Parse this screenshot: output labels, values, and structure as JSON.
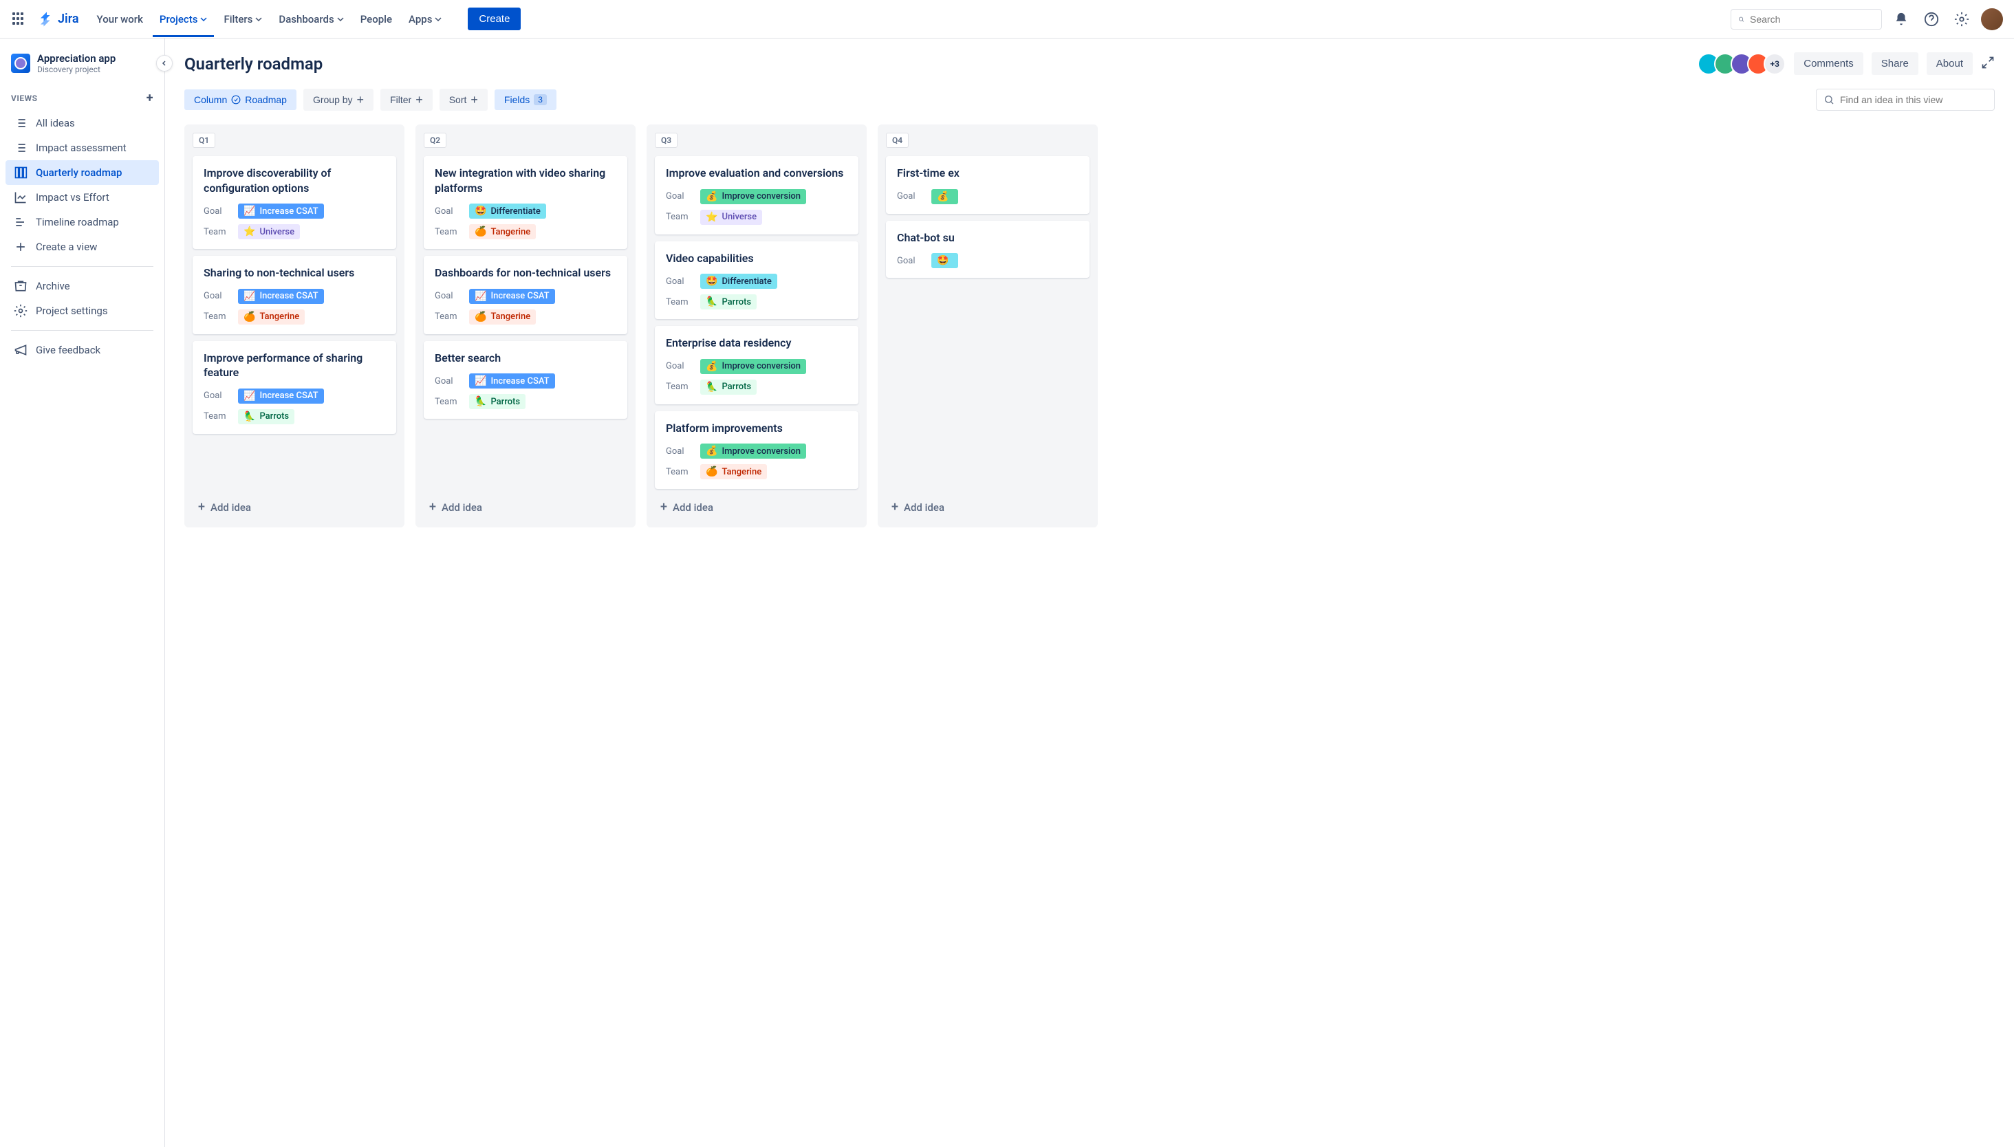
{
  "topbar": {
    "logo": "Jira",
    "nav": [
      "Your work",
      "Projects",
      "Filters",
      "Dashboards",
      "People",
      "Apps"
    ],
    "active_nav": "Projects",
    "create_label": "Create",
    "search_placeholder": "Search"
  },
  "sidebar": {
    "project_name": "Appreciation app",
    "project_type": "Discovery project",
    "views_label": "VIEWS",
    "items": [
      {
        "label": "All ideas",
        "icon": "list"
      },
      {
        "label": "Impact assessment",
        "icon": "list"
      },
      {
        "label": "Quarterly roadmap",
        "icon": "board",
        "active": true
      },
      {
        "label": "Impact vs Effort",
        "icon": "chart"
      },
      {
        "label": "Timeline roadmap",
        "icon": "timeline"
      },
      {
        "label": "Create a view",
        "icon": "plus"
      }
    ],
    "archive_label": "Archive",
    "settings_label": "Project settings",
    "feedback_label": "Give feedback"
  },
  "main": {
    "title": "Quarterly roadmap",
    "avatar_more": "+3",
    "comments_label": "Comments",
    "share_label": "Share",
    "about_label": "About",
    "toolbar": {
      "column_label": "Column",
      "column_value": "Roadmap",
      "groupby_label": "Group by",
      "filter_label": "Filter",
      "sort_label": "Sort",
      "fields_label": "Fields",
      "fields_count": "3",
      "find_placeholder": "Find an idea in this view"
    },
    "field_goal": "Goal",
    "field_team": "Team",
    "add_idea_label": "Add idea",
    "columns": [
      {
        "name": "Q1",
        "cards": [
          {
            "title": "Improve discoverability of configuration options",
            "goal": {
              "text": "Increase CSAT",
              "emoji": "📈",
              "class": "tag-csat"
            },
            "team": {
              "text": "Universe",
              "emoji": "⭐",
              "class": "tag-universe"
            }
          },
          {
            "title": "Sharing to non-technical users",
            "goal": {
              "text": "Increase CSAT",
              "emoji": "📈",
              "class": "tag-csat"
            },
            "team": {
              "text": "Tangerine",
              "emoji": "🍊",
              "class": "tag-tangerine"
            }
          },
          {
            "title": "Improve performance of sharing feature",
            "goal": {
              "text": "Increase CSAT",
              "emoji": "📈",
              "class": "tag-csat"
            },
            "team": {
              "text": "Parrots",
              "emoji": "🦜",
              "class": "tag-parrots"
            }
          }
        ]
      },
      {
        "name": "Q2",
        "cards": [
          {
            "title": "New integration with video sharing platforms",
            "goal": {
              "text": "Differentiate",
              "emoji": "🤩",
              "class": "tag-diff"
            },
            "team": {
              "text": "Tangerine",
              "emoji": "🍊",
              "class": "tag-tangerine"
            }
          },
          {
            "title": "Dashboards for non-technical users",
            "goal": {
              "text": "Increase CSAT",
              "emoji": "📈",
              "class": "tag-csat"
            },
            "team": {
              "text": "Tangerine",
              "emoji": "🍊",
              "class": "tag-tangerine"
            }
          },
          {
            "title": "Better search",
            "goal": {
              "text": "Increase CSAT",
              "emoji": "📈",
              "class": "tag-csat"
            },
            "team": {
              "text": "Parrots",
              "emoji": "🦜",
              "class": "tag-parrots"
            }
          }
        ]
      },
      {
        "name": "Q3",
        "cards": [
          {
            "title": "Improve evaluation and conversions",
            "goal": {
              "text": "Improve conversion",
              "emoji": "💰",
              "class": "tag-conv"
            },
            "team": {
              "text": "Universe",
              "emoji": "⭐",
              "class": "tag-universe"
            }
          },
          {
            "title": "Video capabilities",
            "goal": {
              "text": "Differentiate",
              "emoji": "🤩",
              "class": "tag-diff"
            },
            "team": {
              "text": "Parrots",
              "emoji": "🦜",
              "class": "tag-parrots"
            }
          },
          {
            "title": "Enterprise data residency",
            "goal": {
              "text": "Improve conversion",
              "emoji": "💰",
              "class": "tag-conv"
            },
            "team": {
              "text": "Parrots",
              "emoji": "🦜",
              "class": "tag-parrots"
            }
          },
          {
            "title": "Platform improvements",
            "goal": {
              "text": "Improve conversion",
              "emoji": "💰",
              "class": "tag-conv"
            },
            "team": {
              "text": "Tangerine",
              "emoji": "🍊",
              "class": "tag-tangerine"
            }
          }
        ]
      },
      {
        "name": "Q4",
        "cards": [
          {
            "title": "First-time ex",
            "goal": {
              "text": "",
              "emoji": "💰",
              "class": "tag-conv"
            },
            "team": null
          },
          {
            "title": "Chat-bot su",
            "goal": {
              "text": "",
              "emoji": "🤩",
              "class": "tag-diff"
            },
            "team": null
          }
        ]
      }
    ]
  }
}
